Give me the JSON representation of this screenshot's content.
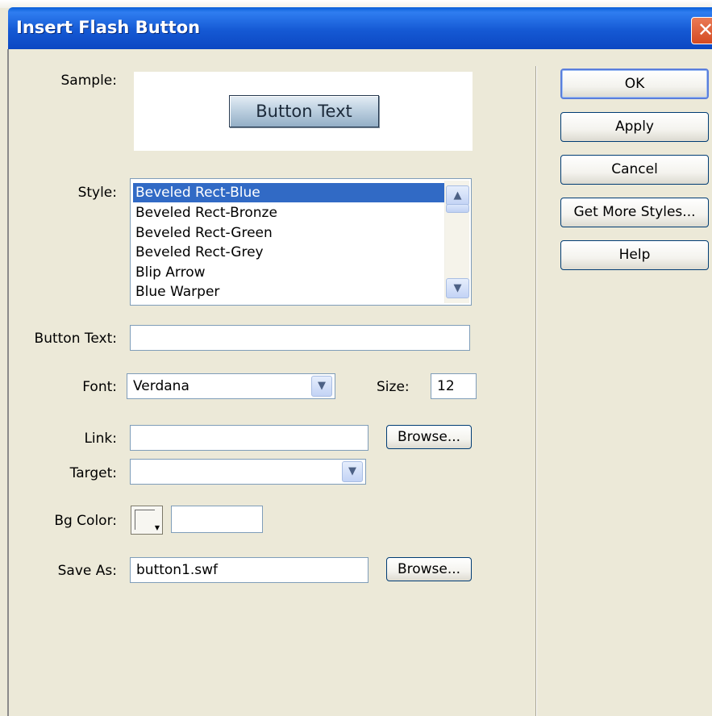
{
  "window": {
    "title": "Insert Flash Button",
    "close_glyph": "✕"
  },
  "sample": {
    "label": "Sample:",
    "button_text": "Button Text"
  },
  "style": {
    "label": "Style:",
    "items": [
      "Beveled Rect-Blue",
      "Beveled Rect-Bronze",
      "Beveled Rect-Green",
      "Beveled Rect-Grey",
      "Blip Arrow",
      "Blue Warper"
    ],
    "selected": "Beveled Rect-Blue"
  },
  "button_text": {
    "label": "Button Text:",
    "value": ""
  },
  "font": {
    "label": "Font:",
    "value": "Verdana"
  },
  "size": {
    "label": "Size:",
    "value": "12"
  },
  "link": {
    "label": "Link:",
    "value": "",
    "browse_label": "Browse..."
  },
  "target": {
    "label": "Target:",
    "value": ""
  },
  "bg_color": {
    "label": "Bg Color:",
    "value": ""
  },
  "save_as": {
    "label": "Save As:",
    "value": "button1.swf",
    "browse_label": "Browse..."
  },
  "buttons": {
    "ok": "OK",
    "apply": "Apply",
    "cancel": "Cancel",
    "get_more_styles": "Get More Styles...",
    "help": "Help"
  },
  "icons": {
    "scroll_up": "scroll-up-icon",
    "scroll_down": "scroll-down-icon",
    "dropdown": "chevron-down-icon",
    "close": "close-icon",
    "color_picker": "color-swatch-icon"
  },
  "colors": {
    "titlebar": "#0c47c2",
    "selection": "#316ac5",
    "dialog_bg": "#ece9d8"
  }
}
